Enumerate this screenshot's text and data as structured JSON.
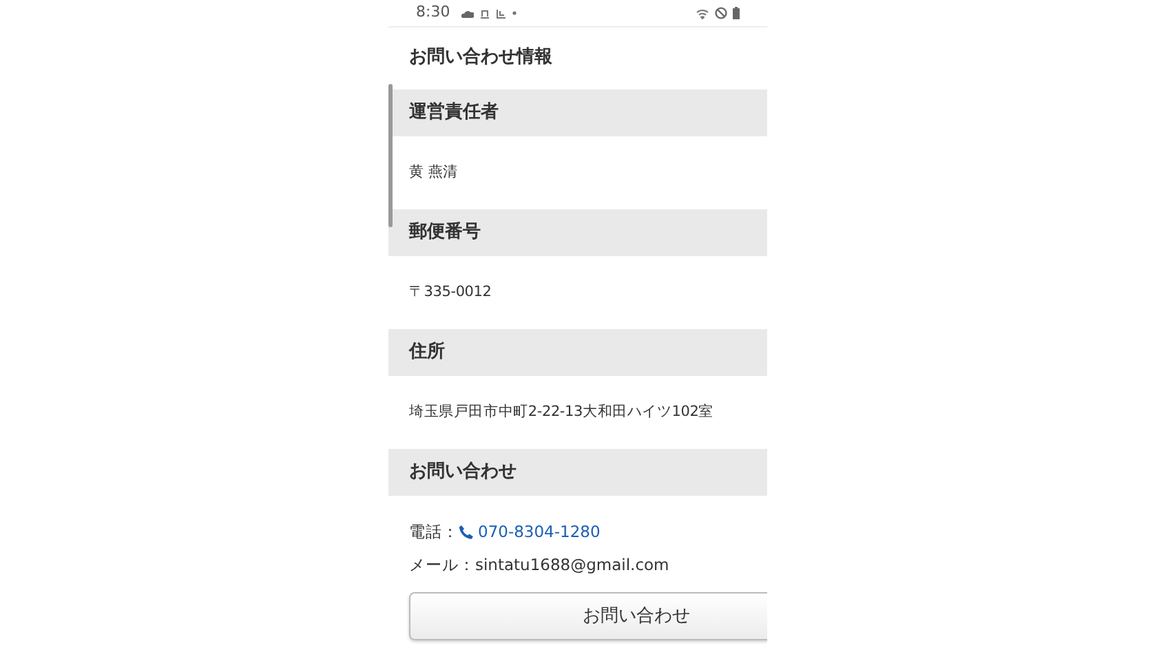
{
  "status_bar": {
    "time": "8:30"
  },
  "title": "お問い合わせ情報",
  "sections": [
    {
      "heading": "運営責任者",
      "value": "黄 燕清"
    },
    {
      "heading": "郵便番号",
      "value": "〒335-0012"
    },
    {
      "heading": "住所",
      "value": "埼玉県戸田市中町2-22-13大和田ハイツ102室"
    }
  ],
  "contact": {
    "heading": "お問い合わせ",
    "phone_label": "電話：",
    "phone": "070-8304-1280",
    "email_line": "メール：sintatu1688@gmail.com",
    "button": "お問い合わせ"
  }
}
